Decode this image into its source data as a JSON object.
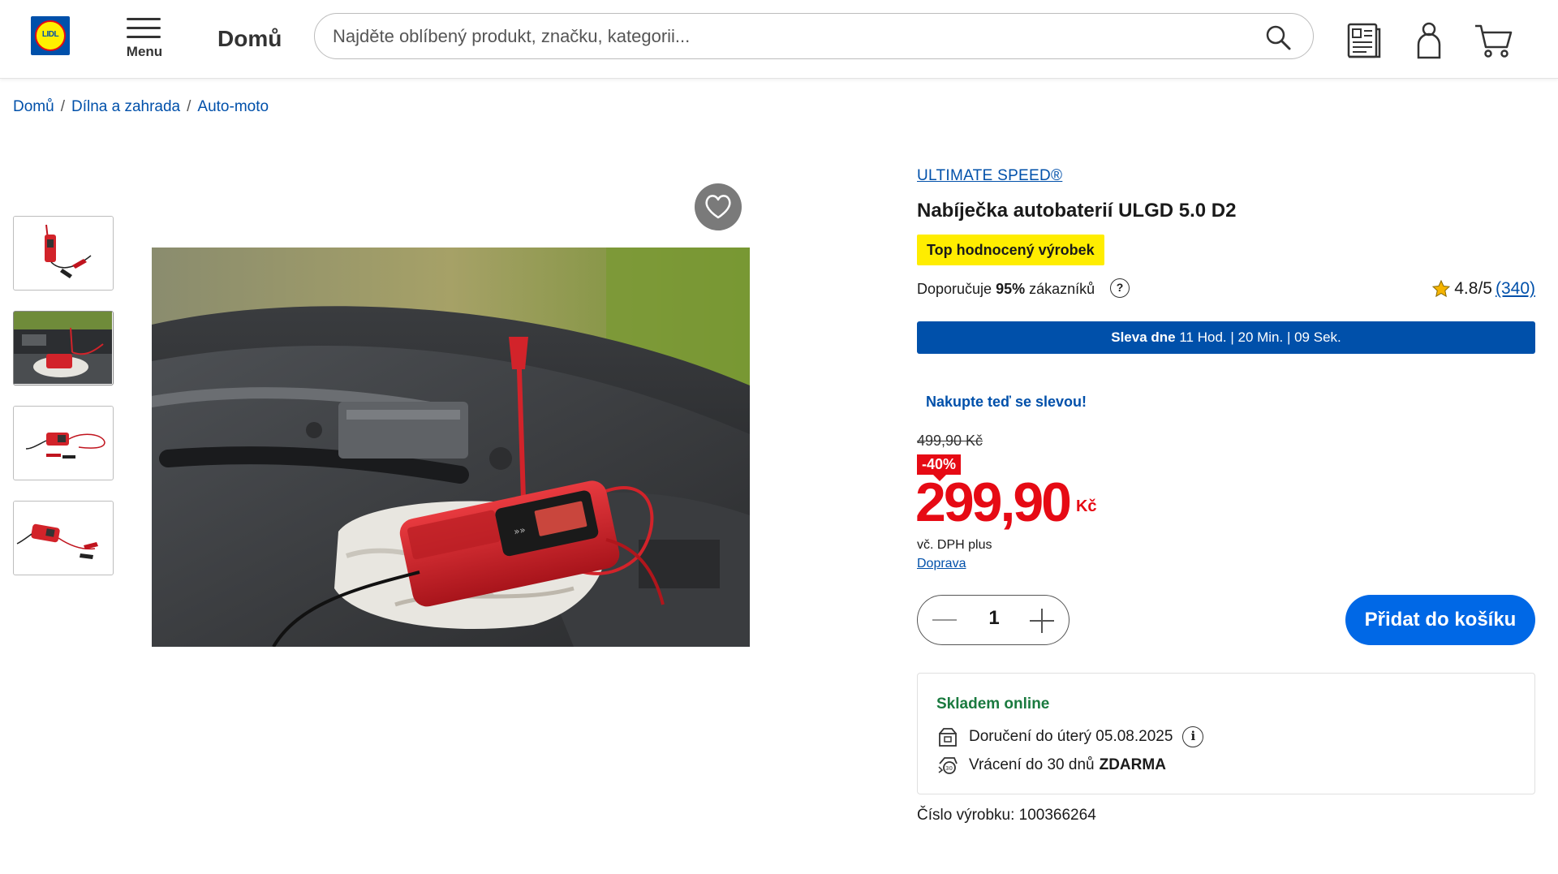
{
  "header": {
    "logo_text": "LIDL",
    "menu_label": "Menu",
    "home_title": "Domů",
    "search_placeholder": "Najděte oblíbený produkt, značku, kategorii...",
    "icons": [
      "search-icon",
      "leaflet-icon",
      "user-icon",
      "cart-icon"
    ]
  },
  "breadcrumb": [
    "Domů",
    "Dílna a zahrada",
    "Auto-moto"
  ],
  "gallery": {
    "thumbnails": [
      "thumbnail-1",
      "thumbnail-2",
      "thumbnail-3",
      "thumbnail-4"
    ]
  },
  "product": {
    "brand": "ULTIMATE SPEED®",
    "title": "Nabíječka autobaterií ULGD 5.0 D2",
    "top_badge": "Top hodnocený výrobek",
    "recommend_prefix": "Doporučuje",
    "recommend_percent": "95%",
    "recommend_suffix": "zákazníků",
    "rating": "4.8/5",
    "reviews": "(340)",
    "sale_label": "Sleva dne",
    "sale_timer": "11 Hod. | 20 Min. | 09 Sek.",
    "promo_text": "Nakupte teď se slevou!",
    "old_price": "499,90 Kč",
    "discount": "-40%",
    "price": "299,90",
    "currency": "Kč",
    "vat_text": "vč. DPH plus",
    "shipping_link": "Doprava",
    "quantity": "1",
    "add_to_cart": "Přidat do košíku",
    "stock_status": "Skladem online",
    "delivery_text": "Doručení do úterý 05.08.2025",
    "return_prefix": "Vrácení do 30 dnů",
    "return_free": "ZDARMA",
    "sku": "Číslo výrobku: 100366264"
  },
  "colors": {
    "brand_blue": "#0050aa",
    "cta_blue": "#0068e6",
    "price_red": "#e60a14",
    "badge_yellow": "#ffed00",
    "stock_green": "#1a7a3f"
  }
}
